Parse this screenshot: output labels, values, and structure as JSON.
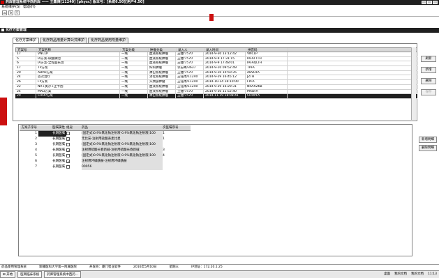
{
  "window": {
    "title": "药库管理系统中西药库 —— 王鑫博[11240]  [physc]  版本号：[系统6.50][用户4.50]",
    "menu": [
      "系统维护(S)",
      "帮助(H)"
    ],
    "toolbar_icons": [
      "home-icon",
      "refresh-icon",
      "filter-icon"
    ]
  },
  "subwindow": {
    "title": "化疗方案管理"
  },
  "tabs": [
    "化疗方案维护",
    "化疗药品用量计算公式维护",
    "化疗药品使用剂量维护"
  ],
  "upper_grid": {
    "headers": [
      "方案号",
      "方案名称",
      "方案分级",
      "肿瘤分类",
      "录入人",
      "录入时间",
      "拼音码"
    ],
    "rows": [
      [
        "17",
        "VNCLP",
        "一线",
        "血液系统肿瘤",
        "王捷/7570",
        "2014-9-30 13:12:42",
        "VNCLP"
      ],
      [
        "5",
        "IA方案-碳酸镧治",
        "一线",
        "血液系统肿瘤",
        "王捷/7570",
        "2014-9-9 17:31:15",
        "IAFATTTH"
      ],
      [
        "6",
        "IA方案-全程益长治",
        "一线",
        "血液系统肿瘤",
        "王捷/7570",
        "2014-9-9 17:48:01",
        "IAFAQLTH"
      ],
      [
        "17",
        "TP方案",
        "一线",
        "妇科肿瘤",
        "李志峰/3637",
        "2014-9-10 09:52:49",
        "TPFA"
      ],
      [
        "20",
        "ABVD方案",
        "一线",
        "淋巴系统肿瘤",
        "王捷/7570",
        "2014-9-10 10:50:35",
        "ABVDFA"
      ],
      [
        "24",
        "首次治疗",
        "一线",
        "消化系统肿瘤",
        "王钰博/11240",
        "2014-9-29 16:45:12",
        "JZTB"
      ],
      [
        "26",
        "FP方案",
        "一线",
        "头颈部肿瘤",
        "王钰博/11240",
        "2014-10-14 16:10:00",
        "FPFA"
      ],
      [
        "22",
        "NR+奥沙+止卡因",
        "二线",
        "血液系统肿瘤",
        "王钰博/11240",
        "2014-9-29 16:29:31",
        "NRAXZKB"
      ],
      [
        "24",
        "MAD方案",
        "一线",
        "血液系统肿瘤",
        "王捷/7570",
        "2014-9-30 11:52:40",
        "MADFA"
      ],
      [
        "29",
        "CHOP方案",
        "一线",
        "淋巴系统肿瘤",
        "王捷/7570",
        "2014-11-19 18:08:41",
        "CHOPFA"
      ]
    ],
    "selected_index": 9
  },
  "upper_buttons": [
    "刷新",
    "新增",
    "删除",
    "保存"
  ],
  "lower_grid": {
    "headers": [
      "方案子序号",
      "医嘱属性",
      "组返",
      "药品",
      "次医嘱序号"
    ],
    "rows": [
      [
        "1",
        "长期医嘱",
        "",
        "(固定式)0.9%氯化钠注射液-0.9%氯化钠注射液(100",
        "1"
      ],
      [
        "2",
        "长期医嘱",
        "",
        "无比安-注射用盐酸表柔比星",
        "1"
      ],
      [
        "3",
        "长期医嘱",
        "",
        "(固定式)0.9%氯化钠注射液-0.9%氯化钠注射液(100",
        ""
      ],
      [
        "4",
        "长期医嘱",
        "",
        "注射用硫酸长春新碱-注射用硫酸长春新碱",
        "3"
      ],
      [
        "5",
        "长期医嘱",
        "",
        "(固定式)0.9%氯化钠注射液-0.9%氯化钠注射液(100",
        "4"
      ],
      [
        "6",
        "长期医嘱",
        "",
        "注射用环磷酰胺-注射用环磷酰胺",
        ""
      ],
      [
        "7",
        "长期医嘱",
        "",
        "00056",
        ""
      ]
    ],
    "combo_value": "长期医嘱"
  },
  "lower_buttons": [
    "新增明细",
    "删除明细"
  ],
  "statusbar": [
    "药品使用管理系统",
    "新疆医科大学第一附属医院",
    "开发商：厦门智业软件",
    "2016年5月10日",
    "星期三",
    "IP地址：172.20.1.25"
  ],
  "taskbar": {
    "start": "开始",
    "tasks": [
      "医网临床系统",
      "药库管理系统中西药..."
    ],
    "tray": [
      "桌面",
      "我的文档",
      "我的文档"
    ],
    "clock": "11:13"
  }
}
